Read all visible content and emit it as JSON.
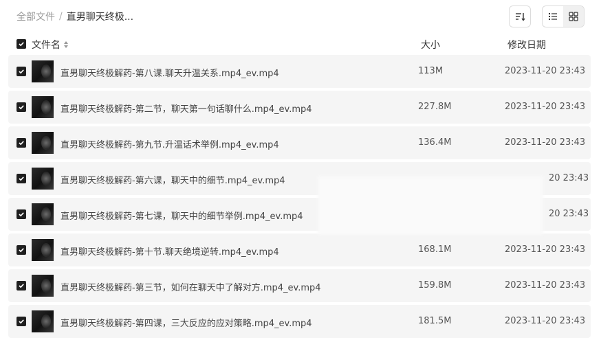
{
  "breadcrumb": {
    "root": "全部文件",
    "separator": "/",
    "current": "直男聊天终极..."
  },
  "toolbar": {
    "sort_icon": "sort-descending-icon",
    "list_icon": "list-view-icon",
    "grid_icon": "grid-view-icon"
  },
  "header": {
    "name": "文件名",
    "size": "大小",
    "date": "修改日期"
  },
  "files": [
    {
      "name": "直男聊天终极解药-第八课.聊天升温关系.mp4_ev.mp4",
      "size": "113M",
      "date": "2023-11-20 23:43"
    },
    {
      "name": "直男聊天终极解药-第二节，聊天第一句话聊什么.mp4_ev.mp4",
      "size": "227.8M",
      "date": "2023-11-20 23:43"
    },
    {
      "name": "直男聊天终极解药-第九节.升温话术举例.mp4_ev.mp4",
      "size": "136.4M",
      "date": "2023-11-20 23:43"
    },
    {
      "name": "直男聊天终极解药-第六课，聊天中的细节.mp4_ev.mp4",
      "size": "",
      "date": "20 23:43"
    },
    {
      "name": "直男聊天终极解药-第七课，聊天中的细节举例.mp4_ev.mp4",
      "size": "",
      "date": "20 23:43"
    },
    {
      "name": "直男聊天终极解药-第十节.聊天绝境逆转.mp4_ev.mp4",
      "size": "168.1M",
      "date": "2023-11-20 23:43"
    },
    {
      "name": "直男聊天终极解药-第三节，如何在聊天中了解对方.mp4_ev.mp4",
      "size": "159.8M",
      "date": "2023-11-20 23:43"
    },
    {
      "name": "直男聊天终极解药-第四课，三大反应的应对策略.mp4_ev.mp4",
      "size": "181.5M",
      "date": "2023-11-20 23:43"
    }
  ]
}
